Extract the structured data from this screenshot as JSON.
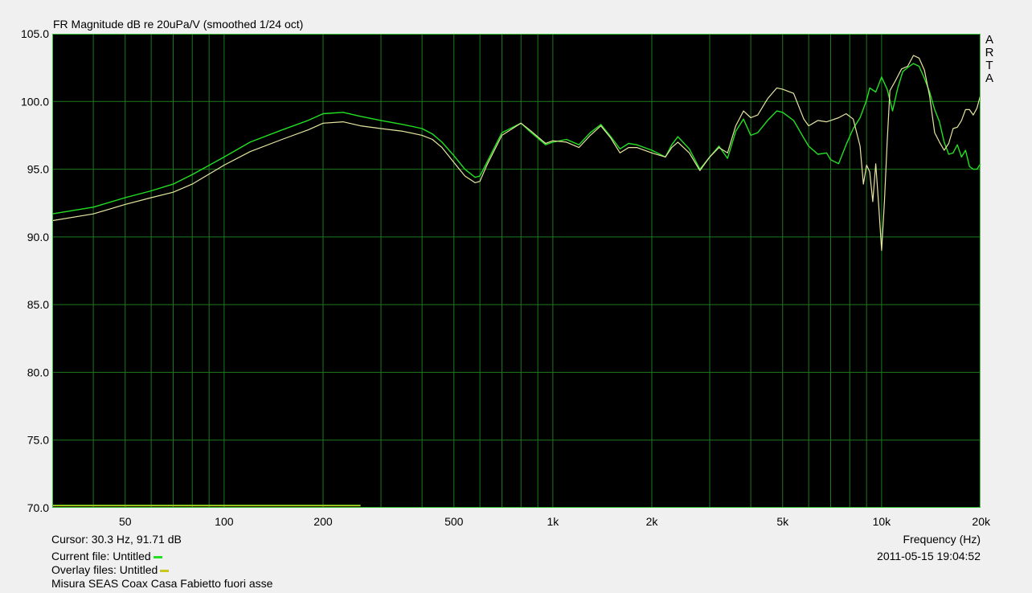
{
  "title": "FR Magnitude dB re 20uPa/V (smoothed 1/24 oct)",
  "brand": [
    "A",
    "R",
    "T",
    "A"
  ],
  "x_axis_label": "Frequency (Hz)",
  "cursor_text": "Cursor: 30.3 Hz, 91.71 dB",
  "current_file_text": "Current file: Untitled",
  "overlay_files_text": "Overlay files: Untitled",
  "description": "Misura SEAS Coax Casa Fabietto fuori asse",
  "timestamp": "2011-05-15  19:04:52",
  "colors": {
    "background": "#000000",
    "grid": "#1e7a1e",
    "frame": "#3cc83c",
    "current": "#22e022",
    "overlay": "#e6e6a0",
    "overlay_swatch": "#c8c81e"
  },
  "chart_data": {
    "type": "line",
    "title": "FR Magnitude dB re 20uPa/V (smoothed 1/24 oct)",
    "xlabel": "Frequency (Hz)",
    "ylabel": "",
    "xscale": "log",
    "xlim": [
      30,
      20000
    ],
    "ylim": [
      70,
      105
    ],
    "grid": true,
    "x_tick_labels": [
      {
        "v": 50,
        "t": "50"
      },
      {
        "v": 100,
        "t": "100"
      },
      {
        "v": 200,
        "t": "200"
      },
      {
        "v": 500,
        "t": "500"
      },
      {
        "v": 1000,
        "t": "1k"
      },
      {
        "v": 2000,
        "t": "2k"
      },
      {
        "v": 5000,
        "t": "5k"
      },
      {
        "v": 10000,
        "t": "10k"
      },
      {
        "v": 20000,
        "t": "20k"
      }
    ],
    "y_tick_labels": [
      "70.0",
      "75.0",
      "80.0",
      "85.0",
      "90.0",
      "95.0",
      "100.0",
      "105.0"
    ],
    "series": [
      {
        "role": "current",
        "color": "#22e022",
        "x": [
          30,
          40,
          50,
          60,
          70,
          80,
          100,
          120,
          150,
          180,
          200,
          230,
          260,
          300,
          350,
          400,
          430,
          460,
          500,
          540,
          580,
          600,
          630,
          700,
          800,
          850,
          950,
          1000,
          1100,
          1200,
          1300,
          1400,
          1500,
          1600,
          1700,
          1800,
          2000,
          2200,
          2300,
          2400,
          2600,
          2800,
          3000,
          3200,
          3400,
          3600,
          3800,
          4000,
          4200,
          4500,
          4800,
          5000,
          5400,
          5800,
          6000,
          6400,
          6800,
          7000,
          7400,
          7800,
          8200,
          8600,
          9000,
          9200,
          9600,
          10000,
          10400,
          10800,
          11200,
          11600,
          12000,
          12500,
          13000,
          13500,
          14000,
          14500,
          15000,
          15500,
          16000,
          16500,
          17000,
          17500,
          18000,
          18500,
          19000,
          19500,
          20000
        ],
        "y": [
          91.7,
          92.2,
          92.9,
          93.4,
          93.9,
          94.6,
          95.9,
          97.0,
          97.9,
          98.6,
          99.1,
          99.2,
          98.9,
          98.6,
          98.3,
          98.0,
          97.6,
          97.0,
          96.0,
          95.0,
          94.4,
          94.5,
          95.5,
          97.7,
          98.4,
          97.8,
          96.8,
          97.0,
          97.2,
          96.8,
          97.7,
          98.3,
          97.4,
          96.5,
          96.9,
          96.8,
          96.4,
          95.9,
          96.8,
          97.4,
          96.5,
          95.0,
          95.9,
          96.7,
          95.8,
          97.8,
          98.7,
          97.5,
          97.7,
          98.6,
          99.3,
          99.2,
          98.6,
          97.3,
          96.7,
          96.1,
          96.2,
          95.7,
          95.4,
          96.8,
          98.0,
          98.8,
          100.1,
          101.0,
          100.7,
          101.8,
          100.9,
          99.3,
          101.0,
          102.2,
          102.5,
          102.8,
          102.6,
          101.7,
          100.7,
          99.4,
          98.5,
          97.0,
          96.1,
          96.2,
          96.8,
          95.9,
          96.4,
          95.2,
          95.0,
          95.0,
          95.4
        ]
      },
      {
        "role": "overlay",
        "color": "#e6e6a0",
        "x": [
          30,
          40,
          50,
          60,
          70,
          80,
          100,
          120,
          150,
          180,
          200,
          230,
          260,
          300,
          350,
          400,
          430,
          460,
          500,
          540,
          580,
          600,
          630,
          700,
          800,
          850,
          950,
          1000,
          1100,
          1200,
          1300,
          1400,
          1500,
          1600,
          1700,
          1800,
          2000,
          2200,
          2300,
          2400,
          2600,
          2800,
          3000,
          3200,
          3400,
          3600,
          3800,
          4000,
          4200,
          4500,
          4800,
          5000,
          5400,
          5800,
          6000,
          6400,
          6800,
          7000,
          7400,
          7800,
          8200,
          8600,
          8800,
          9000,
          9200,
          9400,
          9600,
          9800,
          10000,
          10200,
          10400,
          10600,
          11000,
          11500,
          12000,
          12500,
          13000,
          13500,
          14000,
          14500,
          15000,
          15500,
          16000,
          16500,
          17000,
          17500,
          18000,
          18500,
          19000,
          19500,
          20000
        ],
        "y": [
          91.2,
          91.7,
          92.4,
          92.9,
          93.3,
          93.9,
          95.3,
          96.3,
          97.2,
          97.9,
          98.4,
          98.5,
          98.2,
          98.0,
          97.8,
          97.5,
          97.2,
          96.6,
          95.5,
          94.5,
          94.0,
          94.1,
          95.3,
          97.5,
          98.4,
          97.9,
          96.9,
          97.1,
          97.0,
          96.6,
          97.5,
          98.2,
          97.3,
          96.2,
          96.6,
          96.6,
          96.2,
          95.9,
          96.6,
          97.0,
          96.2,
          94.9,
          95.9,
          96.6,
          96.2,
          98.2,
          99.3,
          98.8,
          99.0,
          100.2,
          101.0,
          100.9,
          100.6,
          98.7,
          98.2,
          98.6,
          98.5,
          98.6,
          98.8,
          99.1,
          98.7,
          96.7,
          93.9,
          95.3,
          94.8,
          92.6,
          95.4,
          92.3,
          89.0,
          92.6,
          97.0,
          100.8,
          101.5,
          102.4,
          102.6,
          103.4,
          103.2,
          102.3,
          100.4,
          97.7,
          97.0,
          96.4,
          96.9,
          98.0,
          98.1,
          98.6,
          99.4,
          99.4,
          99.0,
          99.5,
          100.5
        ]
      }
    ],
    "flat_segment_overlay": {
      "x": [
        30,
        260
      ],
      "y": [
        70.1,
        70.1
      ]
    },
    "flat_segment_current": {
      "x": [
        30,
        260
      ],
      "y": [
        70.2,
        70.2
      ]
    }
  }
}
